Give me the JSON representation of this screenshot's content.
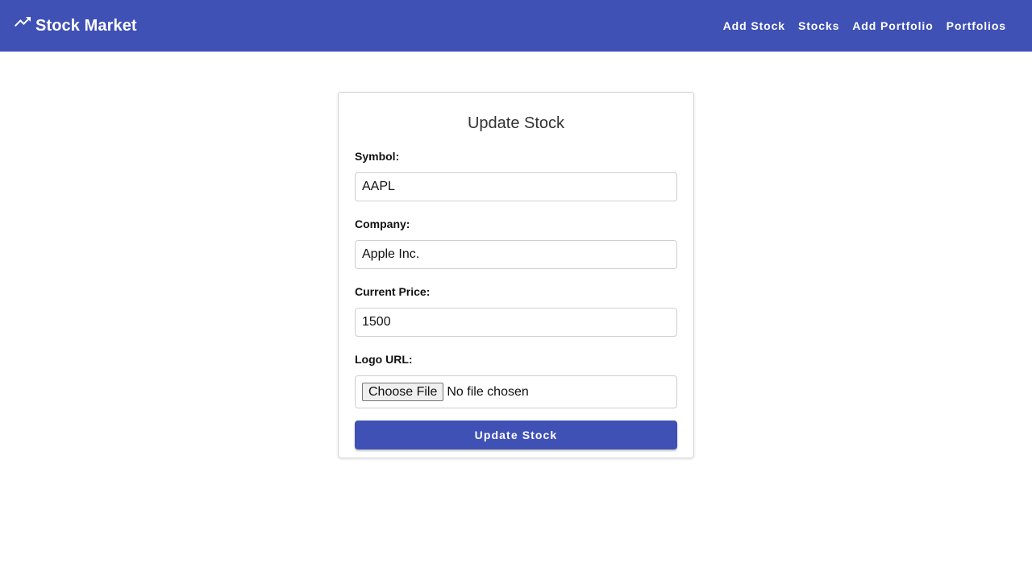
{
  "colors": {
    "primary": "#3f51b5",
    "surface": "#ffffff",
    "border": "#cfcfcf"
  },
  "header": {
    "brand_icon": "trending-up-icon",
    "brand_title": "Stock Market",
    "nav": [
      {
        "label": "Add Stock"
      },
      {
        "label": "Stocks"
      },
      {
        "label": "Add Portfolio"
      },
      {
        "label": "Portfolios"
      }
    ]
  },
  "form": {
    "title": "Update Stock",
    "symbol": {
      "label": "Symbol:",
      "value": "AAPL"
    },
    "company": {
      "label": "Company:",
      "value": "Apple Inc."
    },
    "price": {
      "label": "Current Price:",
      "value": "1500"
    },
    "logo": {
      "label": "Logo URL:",
      "button_label": "Choose File",
      "status": "No file chosen"
    },
    "submit_label": "Update Stock"
  }
}
